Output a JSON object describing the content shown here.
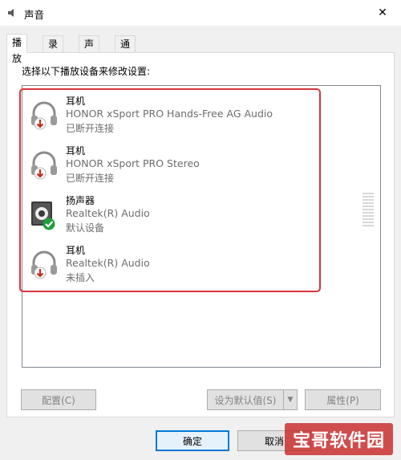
{
  "window": {
    "title": "声音",
    "close_glyph": "✕"
  },
  "tabs": [
    {
      "label": "播放",
      "active": true
    },
    {
      "label": "录制",
      "active": false
    },
    {
      "label": "声音",
      "active": false
    },
    {
      "label": "通信",
      "active": false
    }
  ],
  "panel": {
    "instructions": "选择以下播放设备来修改设置:"
  },
  "devices": [
    {
      "icon": "headphones-icon",
      "badge": "disconnected-arrow-icon",
      "name": "耳机",
      "description": "HONOR xSport PRO Hands-Free AG Audio",
      "status": "已断开连接"
    },
    {
      "icon": "headphones-icon",
      "badge": "disconnected-arrow-icon",
      "name": "耳机",
      "description": "HONOR xSport PRO Stereo",
      "status": "已断开连接"
    },
    {
      "icon": "speaker-icon",
      "badge": "default-check-icon",
      "name": "扬声器",
      "description": "Realtek(R) Audio",
      "status": "默认设备"
    },
    {
      "icon": "headphones-icon",
      "badge": "disconnected-arrow-icon",
      "name": "耳机",
      "description": "Realtek(R) Audio",
      "status": "未插入"
    }
  ],
  "buttons": {
    "configure": "配置(C)",
    "set_default": "设为默认值(S)",
    "properties": "属性(P)",
    "ok": "确定",
    "cancel": "取消"
  },
  "watermark": "宝哥软件园",
  "colors": {
    "highlight": "#d9343c",
    "accent": "#0078d7",
    "check_badge": "#1e9e3a",
    "arrow_badge": "#c42b1c"
  }
}
